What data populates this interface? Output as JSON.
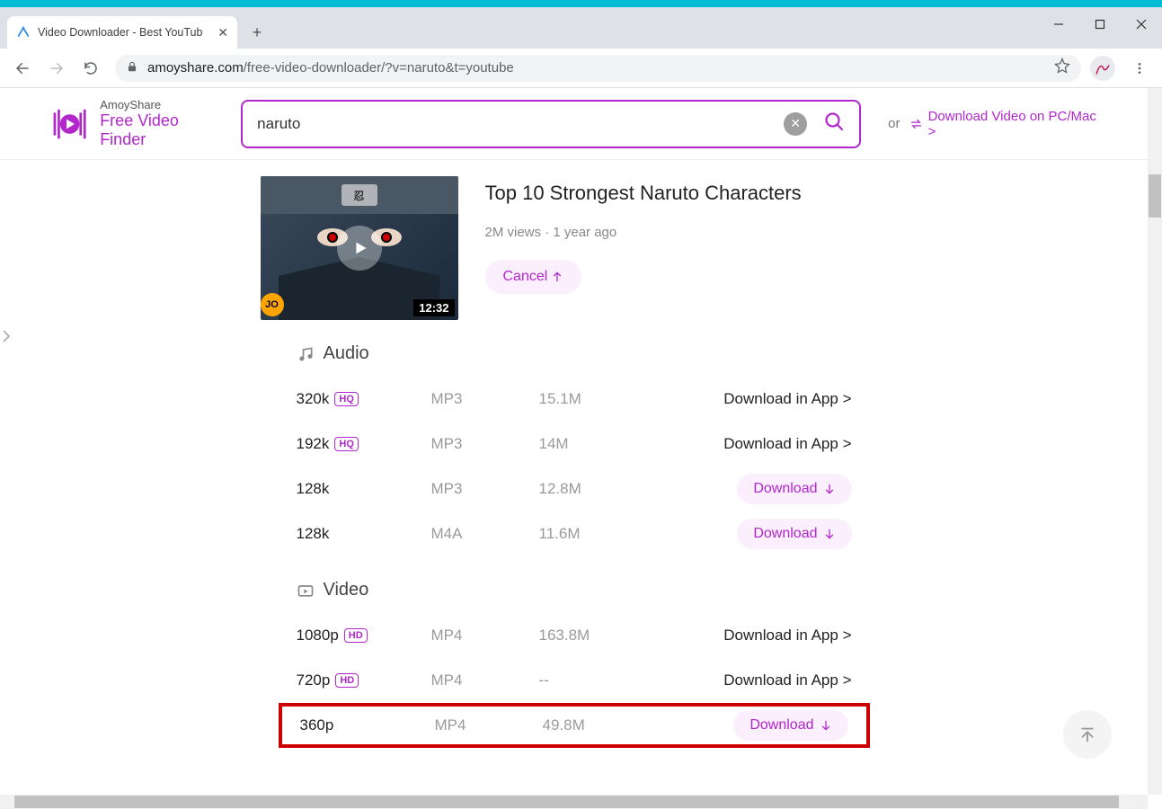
{
  "window": {
    "tab_title": "Video Downloader - Best YouTub"
  },
  "browser": {
    "url_host": "amoyshare.com",
    "url_path": "/free-video-downloader/?v=naruto&t=youtube"
  },
  "site": {
    "brand_top": "AmoyShare",
    "brand_bottom": "Free Video Finder",
    "search_value": "naruto",
    "or_text": "or",
    "download_pc_label": "Download Video on PC/Mac >"
  },
  "video": {
    "title": "Top 10 Strongest Naruto Characters",
    "stats": "2M views · 1 year ago",
    "duration": "12:32",
    "cancel_label": "Cancel",
    "thumb_badge": "JO",
    "thumb_plate": "忍"
  },
  "sections": {
    "audio_title": "Audio",
    "video_title": "Video"
  },
  "audio": [
    {
      "quality": "320k",
      "badge": "HQ",
      "format": "MP3",
      "size": "15.1M",
      "action_type": "app",
      "action_label": "Download in App >"
    },
    {
      "quality": "192k",
      "badge": "HQ",
      "format": "MP3",
      "size": "14M",
      "action_type": "app",
      "action_label": "Download in App >"
    },
    {
      "quality": "128k",
      "badge": "",
      "format": "MP3",
      "size": "12.8M",
      "action_type": "dl",
      "action_label": "Download"
    },
    {
      "quality": "128k",
      "badge": "",
      "format": "M4A",
      "size": "11.6M",
      "action_type": "dl",
      "action_label": "Download"
    }
  ],
  "videos": [
    {
      "quality": "1080p",
      "badge": "HD",
      "format": "MP4",
      "size": "163.8M",
      "action_type": "app",
      "action_label": "Download in App >",
      "highlight": false
    },
    {
      "quality": "720p",
      "badge": "HD",
      "format": "MP4",
      "size": "--",
      "action_type": "app",
      "action_label": "Download in App >",
      "highlight": false
    },
    {
      "quality": "360p",
      "badge": "",
      "format": "MP4",
      "size": "49.8M",
      "action_type": "dl",
      "action_label": "Download",
      "highlight": true
    }
  ]
}
